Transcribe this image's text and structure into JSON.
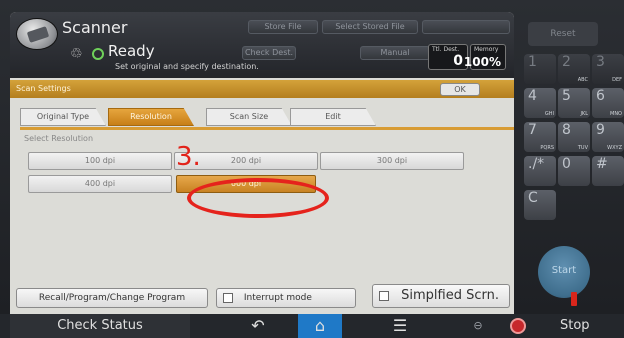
{
  "header": {
    "app_title": "Scanner",
    "ready_text": "Ready",
    "ready_subtext": "Set original and specify destination.",
    "top_buttons": [
      "Store File",
      "Select Stored File"
    ],
    "mid_buttons": [
      "Check Dest.",
      "Manual"
    ],
    "counter_dest": {
      "caption": "Ttl. Dest.",
      "value": "0"
    },
    "counter_memory": {
      "caption": "Memory",
      "value": "100%"
    }
  },
  "section": {
    "title": "Scan Settings",
    "ok_label": "OK"
  },
  "tabs": [
    {
      "label": "Original Type",
      "active": false
    },
    {
      "label": "Resolution",
      "active": true
    },
    {
      "label": "Scan Size",
      "active": false
    },
    {
      "label": "Edit",
      "active": false
    }
  ],
  "select_label": "Select Resolution",
  "resolutions": [
    {
      "label": "100 dpi",
      "selected": false
    },
    {
      "label": "200 dpi",
      "selected": false
    },
    {
      "label": "300 dpi",
      "selected": false
    },
    {
      "label": "400 dpi",
      "selected": false
    },
    {
      "label": "600 dpi",
      "selected": true
    }
  ],
  "annotation": {
    "step_number": "3.",
    "color": "#e5231c"
  },
  "bottom_buttons": {
    "recall": "Recall/Program/Change Program",
    "interrupt": "Interrupt mode",
    "simplified": "Simplfied Scrn."
  },
  "keypad": {
    "reset": "Reset",
    "keys": [
      {
        "main": "1",
        "sub": ""
      },
      {
        "main": "2",
        "sub": "ABC"
      },
      {
        "main": "3",
        "sub": "DEF"
      },
      {
        "main": "4",
        "sub": "GHI"
      },
      {
        "main": "5",
        "sub": "JKL"
      },
      {
        "main": "6",
        "sub": "MNO"
      },
      {
        "main": "7",
        "sub": "PQRS"
      },
      {
        "main": "8",
        "sub": "TUV"
      },
      {
        "main": "9",
        "sub": "WXYZ"
      },
      {
        "main": "./*",
        "sub": ""
      },
      {
        "main": "0",
        "sub": ""
      },
      {
        "main": "#",
        "sub": ""
      },
      {
        "main": "C",
        "sub": ""
      }
    ],
    "start": "Start"
  },
  "taskbar": {
    "check_status": "Check Status",
    "back_icon": "↶",
    "home_icon": "⌂",
    "menu_icon": "☰",
    "extra_icon": "⊖",
    "stop": "Stop"
  },
  "colors": {
    "accent": "#d89c34",
    "home": "#1f79c7",
    "stop": "#c6282c"
  }
}
